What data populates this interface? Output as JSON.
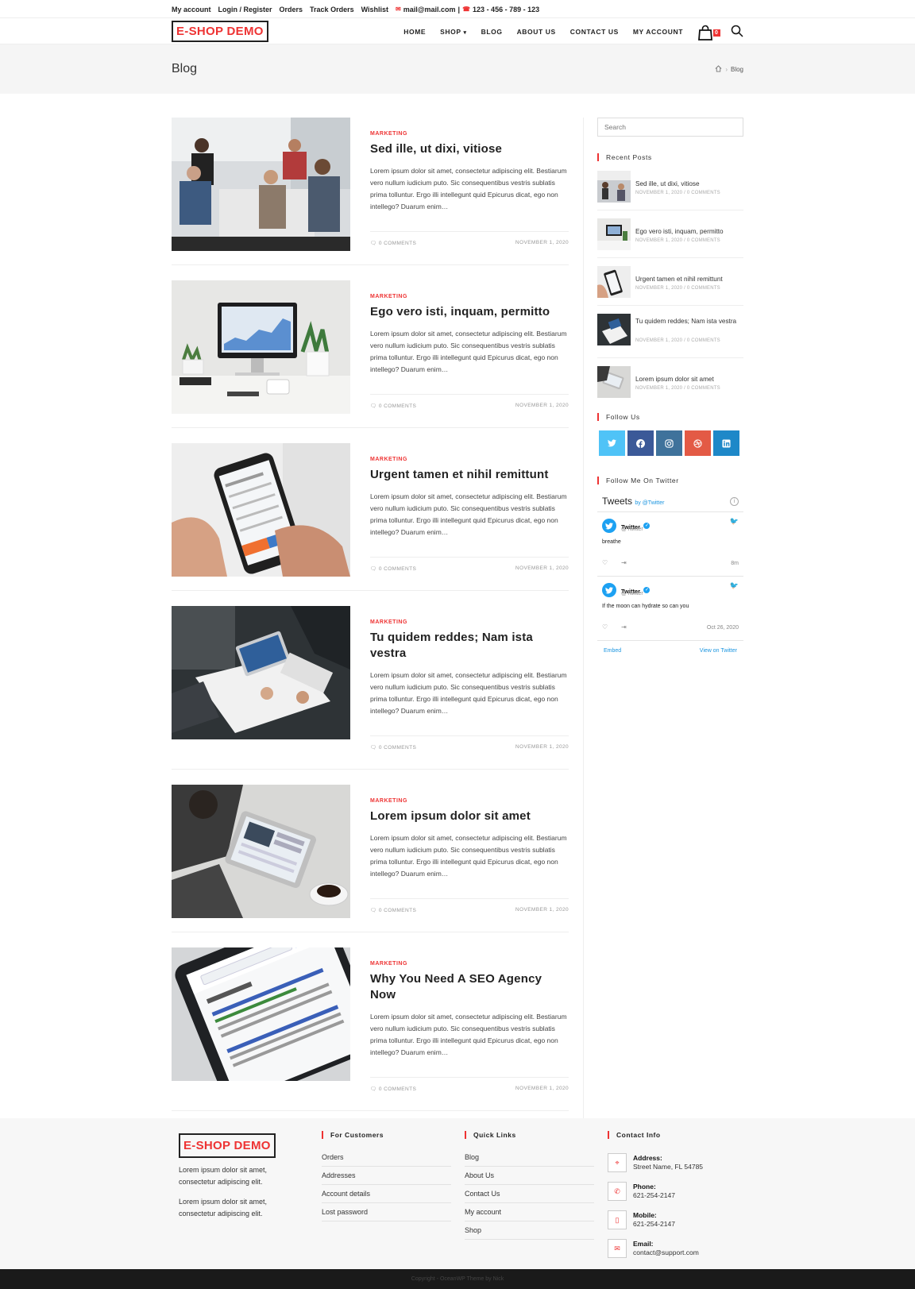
{
  "topbar": {
    "links": [
      "My account",
      "Login / Register",
      "Orders",
      "Track Orders",
      "Wishlist"
    ],
    "email": "mail@mail.com",
    "phone": "123 - 456 - 789 - 123"
  },
  "header": {
    "logo": "E-SHOP DEMO",
    "nav": [
      "HOME",
      "SHOP",
      "BLOG",
      "ABOUT US",
      "CONTACT US",
      "MY ACCOUNT"
    ],
    "cart_count": "0"
  },
  "page_title": {
    "title": "Blog",
    "breadcrumb_current": "Blog"
  },
  "posts": [
    {
      "category": "MARKETING",
      "title": "Sed ille, ut dixi, vitiose",
      "excerpt": "Lorem ipsum dolor sit amet, consectetur adipiscing elit. Bestiarum vero nullum iudicium puto. Sic consequentibus vestris sublatis prima tolluntur. Ergo illi intellegunt quid Epicurus dicat, ego non intellego? Duarum enim…",
      "comments": "0 COMMENTS",
      "date": "NOVEMBER 1, 2020"
    },
    {
      "category": "MARKETING",
      "title": "Ego vero isti, inquam, permitto",
      "excerpt": "Lorem ipsum dolor sit amet, consectetur adipiscing elit. Bestiarum vero nullum iudicium puto. Sic consequentibus vestris sublatis prima tolluntur. Ergo illi intellegunt quid Epicurus dicat, ego non intellego? Duarum enim…",
      "comments": "0 COMMENTS",
      "date": "NOVEMBER 1, 2020"
    },
    {
      "category": "MARKETING",
      "title": "Urgent tamen et nihil remittunt",
      "excerpt": "Lorem ipsum dolor sit amet, consectetur adipiscing elit. Bestiarum vero nullum iudicium puto. Sic consequentibus vestris sublatis prima tolluntur. Ergo illi intellegunt quid Epicurus dicat, ego non intellego? Duarum enim…",
      "comments": "0 COMMENTS",
      "date": "NOVEMBER 1, 2020"
    },
    {
      "category": "MARKETING",
      "title": "Tu quidem reddes; Nam ista vestra",
      "excerpt": "Lorem ipsum dolor sit amet, consectetur adipiscing elit. Bestiarum vero nullum iudicium puto. Sic consequentibus vestris sublatis prima tolluntur. Ergo illi intellegunt quid Epicurus dicat, ego non intellego? Duarum enim…",
      "comments": "0 COMMENTS",
      "date": "NOVEMBER 1, 2020"
    },
    {
      "category": "MARKETING",
      "title": "Lorem ipsum dolor sit amet",
      "excerpt": "Lorem ipsum dolor sit amet, consectetur adipiscing elit. Bestiarum vero nullum iudicium puto. Sic consequentibus vestris sublatis prima tolluntur. Ergo illi intellegunt quid Epicurus dicat, ego non intellego? Duarum enim…",
      "comments": "0 COMMENTS",
      "date": "NOVEMBER 1, 2020"
    },
    {
      "category": "MARKETING",
      "title": "Why You Need A SEO Agency Now",
      "excerpt": "Lorem ipsum dolor sit amet, consectetur adipiscing elit. Bestiarum vero nullum iudicium puto. Sic consequentibus vestris sublatis prima tolluntur. Ergo illi intellegunt quid Epicurus dicat, ego non intellego? Duarum enim…",
      "comments": "0 COMMENTS",
      "date": "NOVEMBER 1, 2020"
    }
  ],
  "sidebar": {
    "search_placeholder": "Search",
    "recent_title": "Recent Posts",
    "recent": [
      {
        "title": "Sed ille, ut dixi, vitiose",
        "meta": "NOVEMBER 1, 2020 / 0 COMMENTS"
      },
      {
        "title": "Ego vero isti, inquam, permitto",
        "meta": "NOVEMBER 1, 2020 / 0 COMMENTS"
      },
      {
        "title": "Urgent tamen et nihil remittunt",
        "meta": "NOVEMBER 1, 2020 / 0 COMMENTS"
      },
      {
        "title": "Tu quidem reddes; Nam ista vestra",
        "meta": "NOVEMBER 1, 2020 / 0 COMMENTS"
      },
      {
        "title": "Lorem ipsum dolor sit amet",
        "meta": "NOVEMBER 1, 2020 / 0 COMMENTS"
      }
    ],
    "follow_title": "Follow Us",
    "social": [
      {
        "name": "twitter-icon",
        "color": "#4fc3f7"
      },
      {
        "name": "facebook-icon",
        "color": "#3b5998"
      },
      {
        "name": "instagram-icon",
        "color": "#3f729b"
      },
      {
        "name": "dribbble-icon",
        "color": "#e35a45"
      },
      {
        "name": "linkedin-icon",
        "color": "#1e88c8"
      }
    ],
    "twitter_title": "Follow Me On Twitter",
    "tweets_header": "Tweets",
    "tweets_by": "by @Twitter",
    "tweets": [
      {
        "name": "Twitter",
        "handle": "@Twitter",
        "text": "breathe",
        "time": "8m"
      },
      {
        "name": "Twitter",
        "handle": "@Twitter",
        "text": "If the moon can hydrate so can you",
        "time": "Oct 26, 2020"
      }
    ],
    "embed": "Embed",
    "view_on": "View on Twitter"
  },
  "footer": {
    "logo": "E-SHOP DEMO",
    "about1": "Lorem ipsum dolor sit amet, consectetur adipiscing elit.",
    "about2": "Lorem ipsum dolor sit amet, consectetur adipiscing elit.",
    "customers_title": "For Customers",
    "customers": [
      "Orders",
      "Addresses",
      "Account details",
      "Lost password"
    ],
    "quick_title": "Quick Links",
    "quick": [
      "Blog",
      "About Us",
      "Contact Us",
      "My account",
      "Shop"
    ],
    "contact_title": "Contact Info",
    "contact": [
      {
        "label": "Address:",
        "value": "Street Name, FL 54785"
      },
      {
        "label": "Phone:",
        "value": "621-254-2147"
      },
      {
        "label": "Mobile:",
        "value": "621-254-2147"
      },
      {
        "label": "Email:",
        "value": "contact@support.com"
      }
    ],
    "copyright": "Copyright - OceanWP Theme by Nick"
  },
  "colors": {
    "accent": "#e33333",
    "footer_bg": "#f7f7f7",
    "bottom_bar": "#1a1a1a"
  }
}
